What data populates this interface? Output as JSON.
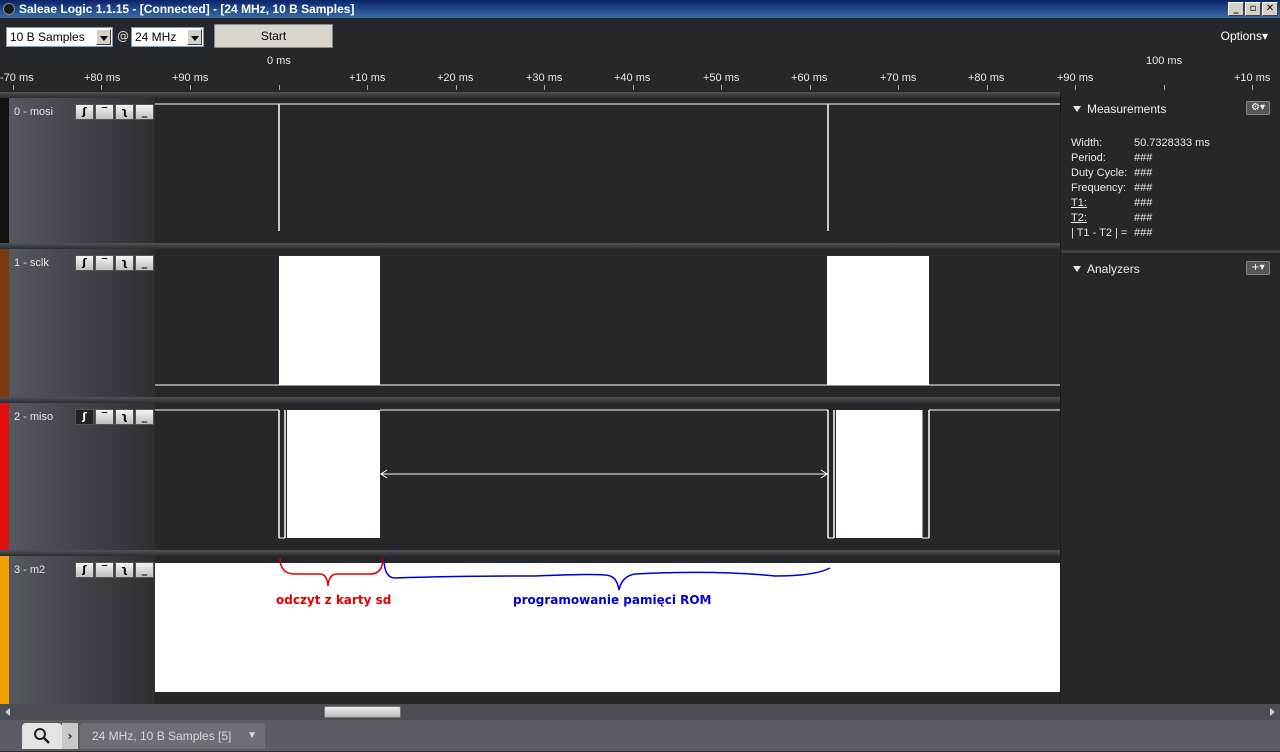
{
  "window": {
    "title": "Saleae Logic 1.1.15 - [Connected] - [24 MHz, 10 B Samples]",
    "minimize": "_",
    "maximize": "▫",
    "close": "✕"
  },
  "toolbar": {
    "samples": "10 B Samples",
    "at": "@",
    "rate": "24 MHz",
    "start": "Start",
    "options": "Options▾"
  },
  "ruler": {
    "labels": [
      "-70 ms",
      "+80 ms",
      "+90 ms",
      "0 ms",
      "+10 ms",
      "+20 ms",
      "+30 ms",
      "+40 ms",
      "+50 ms",
      "+60 ms",
      "+70 ms",
      "+80 ms",
      "+90 ms",
      "100 ms",
      "+10 ms"
    ]
  },
  "channels": [
    {
      "name": "0 - mosi",
      "color": "#111111"
    },
    {
      "name": "1 - sclk",
      "color": "#7a3b10"
    },
    {
      "name": "2 - miso",
      "color": "#e01010"
    },
    {
      "name": "3 - m2",
      "color": "#f0a000"
    }
  ],
  "trigger_icons": [
    "rising-edge-icon",
    "high-level-icon",
    "falling-edge-icon",
    "low-level-icon"
  ],
  "measurements": {
    "title": "Measurements",
    "rows": [
      {
        "label": "Width:",
        "value": "50.7328333 ms"
      },
      {
        "label": "Period:",
        "value": "###"
      },
      {
        "label": "Duty Cycle:",
        "value": "###"
      },
      {
        "label": "Frequency:",
        "value": "###"
      },
      {
        "label": "T1:",
        "value": "###"
      },
      {
        "label": "T2:",
        "value": "###"
      },
      {
        "label": "| T1 - T2 | =",
        "value": "###"
      }
    ]
  },
  "analyzers": {
    "title": "Analyzers"
  },
  "annotations": {
    "red": "odczyt z karty sd",
    "blue": "programowanie pamięci ROM",
    "red_color": "#e00000",
    "blue_color": "#0000cc"
  },
  "bottom": {
    "session_tab": "24 MHz, 10 B Samples [5]",
    "arrow": "›",
    "chevron": "▼"
  }
}
